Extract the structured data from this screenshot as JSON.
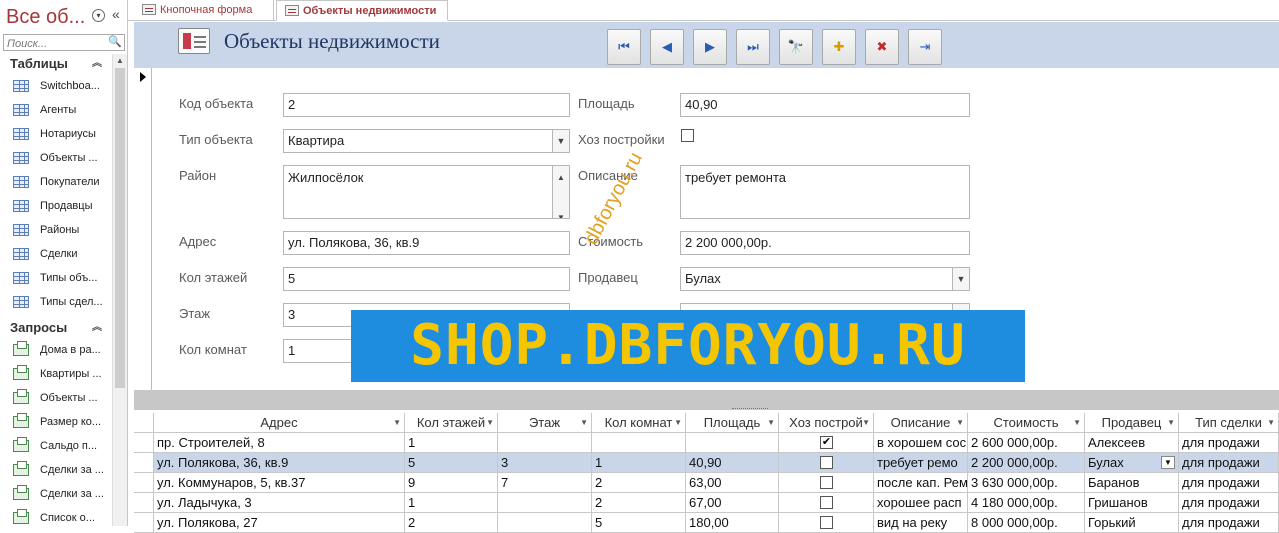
{
  "nav": {
    "title": "Все об...",
    "search_placeholder": "Поиск...",
    "groups": [
      {
        "label": "Таблицы",
        "items": [
          "Switchboa...",
          "Агенты",
          "Нотариусы",
          "Объекты ...",
          "Покупатели",
          "Продавцы",
          "Районы",
          "Сделки",
          "Типы объ...",
          "Типы сдел..."
        ]
      },
      {
        "label": "Запросы",
        "items": [
          "Дома в ра...",
          "Квартиры ...",
          "Объекты ...",
          "Размер ко...",
          "Сальдо  п...",
          "Сделки за ...",
          "Сделки за ...",
          "Список о..."
        ]
      }
    ]
  },
  "tabs": [
    {
      "label": "Кнопочная форма"
    },
    {
      "label": "Объекты недвижимости"
    }
  ],
  "form": {
    "title": "Объекты недвижимости",
    "nav_buttons": [
      {
        "name": "first-record",
        "glyph": "⏮"
      },
      {
        "name": "previous-record",
        "glyph": "◀"
      },
      {
        "name": "next-record",
        "glyph": "▶"
      },
      {
        "name": "last-record",
        "glyph": "⏭"
      },
      {
        "name": "find",
        "glyph": "🔭"
      },
      {
        "name": "new-record",
        "glyph": "✚"
      },
      {
        "name": "delete-record",
        "glyph": "✖"
      },
      {
        "name": "close-form",
        "glyph": "⇥"
      }
    ],
    "labels": {
      "code": "Код объекта",
      "type": "Тип объекта",
      "district": "Район",
      "address": "Адрес",
      "floors": "Кол этажей",
      "floor": "Этаж",
      "rooms": "Кол комнат",
      "area": "Площадь",
      "outbuildings": "Хоз постройки",
      "description": "Описание",
      "price": "Стоимость",
      "seller": "Продавец"
    },
    "values": {
      "code": "2",
      "type": "Квартира",
      "district": "Жилпосёлок",
      "address": "ул. Полякова, 36, кв.9",
      "floors": "5",
      "floor": "3",
      "rooms": "1",
      "area": "40,90",
      "outbuildings": false,
      "description": "требует ремонта",
      "price": "2 200 000,00р.",
      "seller": "Булах"
    }
  },
  "sheet": {
    "columns": [
      "Адрес",
      "Кол этажей",
      "Этаж",
      "Кол комнат",
      "Площадь",
      "Хоз построй",
      "Описание",
      "Стоимость",
      "Продавец",
      "Тип сделки"
    ],
    "rows": [
      {
        "cells": [
          "пр. Строителей, 8",
          "1",
          "",
          "",
          "",
          "",
          "в хорошем сос",
          "2 600 000,00р.",
          "Алексеев",
          "для продажи"
        ],
        "checked": true
      },
      {
        "cells": [
          "ул. Полякова, 36, кв.9",
          "5",
          "3",
          "1",
          "40,90",
          "",
          "требует ремо",
          "2 200 000,00р.",
          "Булах",
          "для продажи"
        ],
        "checked": false
      },
      {
        "cells": [
          "ул. Коммунаров, 5, кв.37",
          "9",
          "7",
          "2",
          "63,00",
          "",
          "после кап. Рем",
          "3 630 000,00р.",
          "Баранов",
          "для продажи"
        ],
        "checked": false
      },
      {
        "cells": [
          "ул. Ладычука, 3",
          "1",
          "",
          "2",
          "67,00",
          "",
          "хорошее расп",
          "4 180 000,00р.",
          "Гришанов",
          "для продажи"
        ],
        "checked": false
      },
      {
        "cells": [
          "ул. Полякова, 27",
          "2",
          "",
          "5",
          "180,00",
          "",
          "вид на реку",
          "8 000 000,00р.",
          "Горький",
          "для продажи"
        ],
        "checked": false
      }
    ]
  },
  "watermarks": {
    "diagonal": "dbforyou.ru",
    "banner": "SHOP.DBFORYOU.RU"
  },
  "colors": {
    "accent": "#a4373a",
    "header_bg": "#c9d6ea",
    "banner_bg": "#1e8de0",
    "banner_text": "#f5c600"
  }
}
